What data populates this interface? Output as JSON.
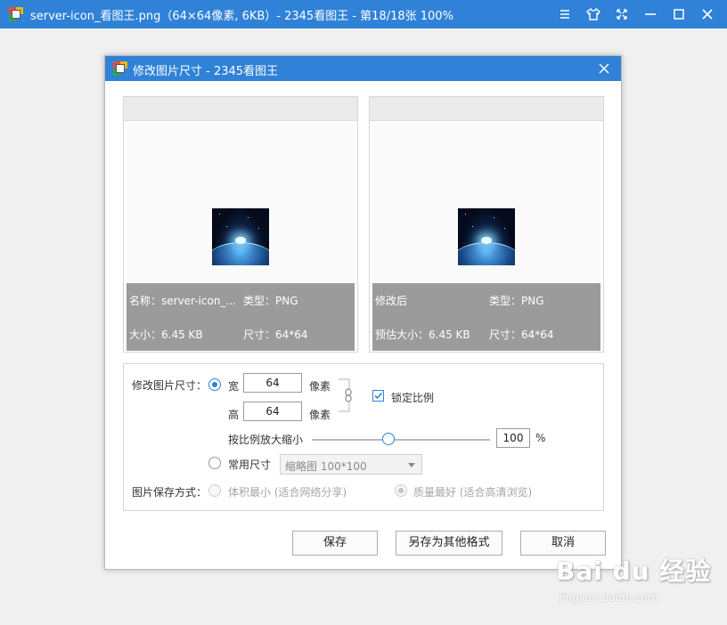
{
  "window": {
    "title": "server-icon_看图王.png（64×64像素, 6KB）- 2345看图王 - 第18/18张 100%"
  },
  "dialog": {
    "title": "修改图片尺寸 - 2345看图王",
    "original": {
      "name_label": "名称：server-icon_...",
      "type_label": "类型：PNG",
      "size_label": "大小：6.45 KB",
      "dims_label": "尺寸：64*64"
    },
    "modified": {
      "name_label": "修改后",
      "type_label": "类型：PNG",
      "size_label": "预估大小：6.45 KB",
      "dims_label": "尺寸：64*64"
    },
    "resize": {
      "label": "修改图片尺寸：",
      "width_label": "宽",
      "width_value": "64",
      "height_label": "高",
      "height_value": "64",
      "unit": "像素",
      "lock_ratio_label": "锁定比例",
      "lock_ratio_checked": true,
      "scale_label": "按比例放大缩小",
      "scale_value": "100",
      "scale_unit": "%",
      "scale_fraction": 0.43,
      "preset_label": "常用尺寸",
      "preset_value": "缩略图 100*100"
    },
    "save_mode": {
      "label": "图片保存方式：",
      "option_small": "体积最小 (适合网络分享)",
      "option_quality": "质量最好 (适合高清浏览)"
    },
    "buttons": {
      "save": "保存",
      "save_as": "另存为其他格式",
      "cancel": "取消"
    }
  },
  "watermark": {
    "logo": "Bai du 经验",
    "sub": "jingyan.baidu.com"
  },
  "colors": {
    "accent": "#2f82d7",
    "info_bar": "#9b9b9b"
  }
}
